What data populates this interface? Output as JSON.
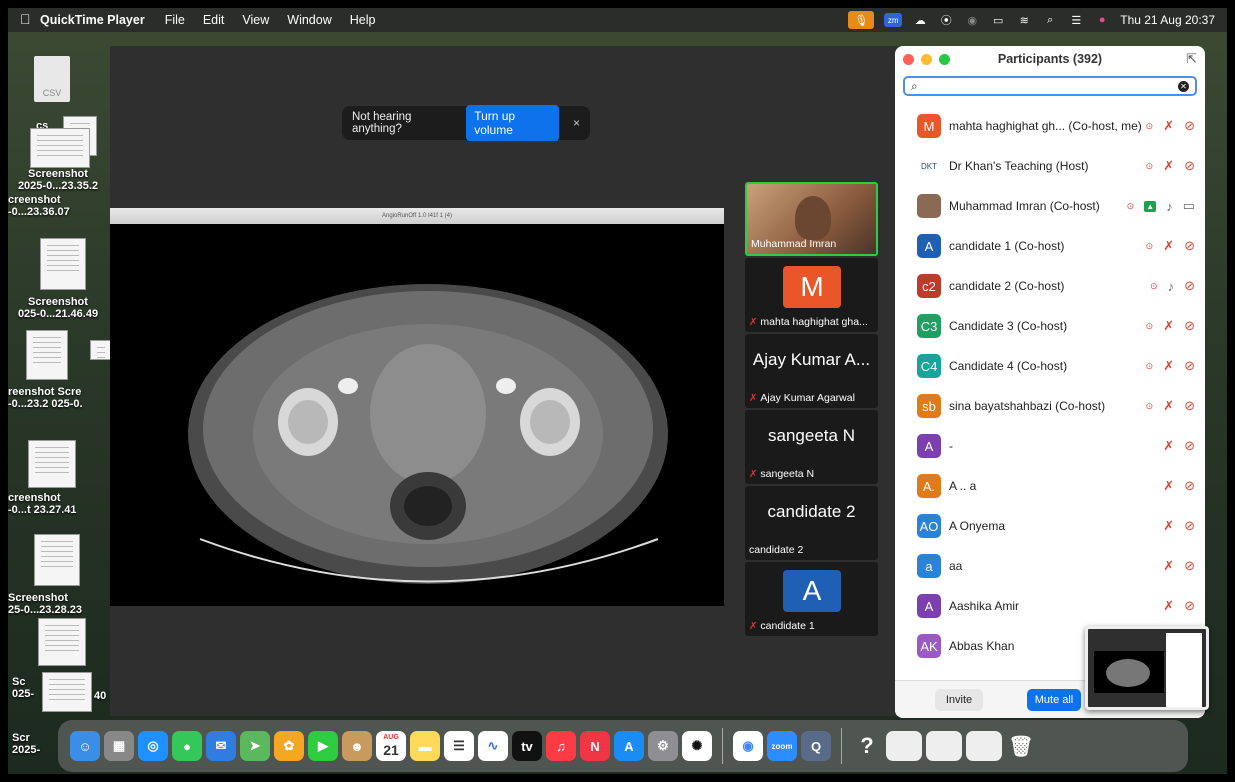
{
  "menubar": {
    "apple": "",
    "app_name": "QuickTime Player",
    "menus": [
      "File",
      "Edit",
      "View",
      "Window",
      "Help"
    ],
    "status_zm": "zm",
    "datetime": "Thu 21 Aug  20:37"
  },
  "desktop": {
    "files": [
      {
        "label1": "CSV",
        "label2": ""
      },
      {
        "label1": "cs",
        "label2": ""
      },
      {
        "label1": "Screenshot",
        "label2": "2025-0...23.35.2"
      },
      {
        "label1": "creenshot",
        "label2": "-0...23.36.07"
      },
      {
        "label1": "Screenshot",
        "label2": "025-0...21.46.49"
      },
      {
        "label1": "reenshot  Scre",
        "label2": "-0...23.2 025-0."
      },
      {
        "label1": "creenshot",
        "label2": "-0...t 23.27.41"
      },
      {
        "label1": "Screenshot",
        "label2": "25-0...23.28.23"
      },
      {
        "label1": "Sc",
        "label2": "025-"
      },
      {
        "label1": "Scr",
        "label2": "2025-"
      },
      {
        "label1": "40",
        "label2": ""
      }
    ]
  },
  "toast": {
    "message": "Not hearing anything?",
    "button": "Turn up volume",
    "close": "×"
  },
  "ct_window": {
    "title": "AngioRunOff 1.0 I41f 1 (4)"
  },
  "gallery": [
    {
      "name": "Muhammad Imran",
      "big": ""
    },
    {
      "name": "mahta haghighat gha...",
      "big": "M"
    },
    {
      "name": "Ajay Kumar Agarwal",
      "big": "Ajay Kumar A..."
    },
    {
      "name": "sangeeta N",
      "big": "sangeeta N"
    },
    {
      "name": "candidate 2",
      "big": "candidate 2"
    },
    {
      "name": "candidate 1",
      "big": "A"
    }
  ],
  "participants_panel": {
    "title": "Participants (392)",
    "search_placeholder": "",
    "rows": [
      {
        "avatar": "M",
        "color": "#e8562a",
        "name": "mahta haghighat gh...  (Co-host, me)"
      },
      {
        "avatar": "DKT",
        "color": "#ffffff",
        "name": "Dr Khan's Teaching (Host)"
      },
      {
        "avatar": "",
        "color": "#8a6a55",
        "name": "Muhammad Imran (Co-host)"
      },
      {
        "avatar": "A",
        "color": "#1f5fb4",
        "name": "candidate 1 (Co-host)"
      },
      {
        "avatar": "c2",
        "color": "#c0392b",
        "name": "candidate 2 (Co-host)"
      },
      {
        "avatar": "C3",
        "color": "#20a060",
        "name": "Candidate 3 (Co-host)"
      },
      {
        "avatar": "C4",
        "color": "#16a59a",
        "name": "Candidate 4 (Co-host)"
      },
      {
        "avatar": "sb",
        "color": "#e07b1a",
        "name": "sina bayatshahbazi (Co-host)"
      },
      {
        "avatar": "A",
        "color": "#7b3fb0",
        "name": "-"
      },
      {
        "avatar": "A.",
        "color": "#e07b1a",
        "name": "A .. a"
      },
      {
        "avatar": "AO",
        "color": "#2b82d9",
        "name": "A Onyema"
      },
      {
        "avatar": "a",
        "color": "#2b82d9",
        "name": "aa"
      },
      {
        "avatar": "A",
        "color": "#7b3fb0",
        "name": "Aashika Amir"
      },
      {
        "avatar": "AK",
        "color": "#9b59c6",
        "name": "Abbas Khan"
      }
    ],
    "invite": "Invite",
    "mute_all": "Mute all"
  },
  "dock": {
    "calendar_month": "AUG",
    "calendar_day": "21",
    "tv_label": "tv",
    "zoom_label": "zoom"
  }
}
